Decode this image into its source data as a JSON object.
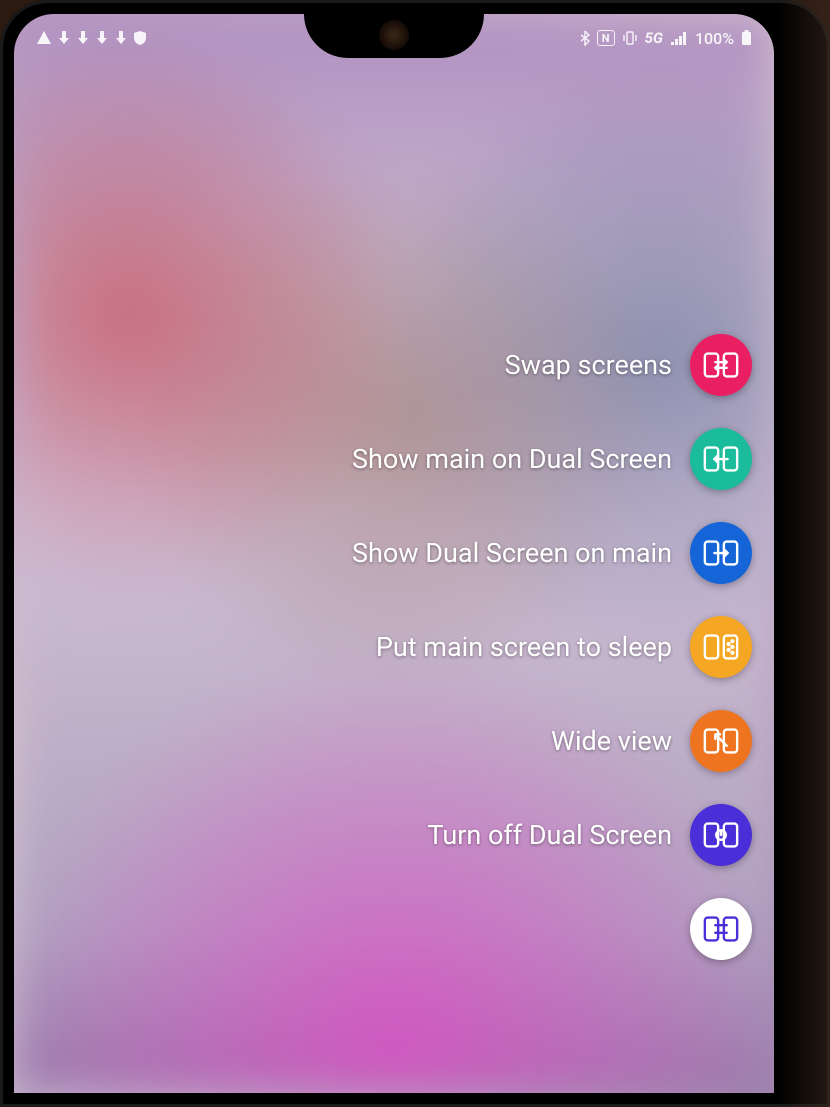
{
  "status_bar": {
    "battery_pct": "100%",
    "network": "5G",
    "nfc": "N"
  },
  "menu": {
    "items": [
      {
        "label": "Swap screens",
        "color": "pink"
      },
      {
        "label": "Show main on Dual Screen",
        "color": "teal"
      },
      {
        "label": "Show Dual Screen on main",
        "color": "blue"
      },
      {
        "label": "Put main screen to sleep",
        "color": "yellow"
      },
      {
        "label": "Wide view",
        "color": "orange"
      },
      {
        "label": "Turn off Dual Screen",
        "color": "purple"
      }
    ],
    "fab_color": "white"
  }
}
